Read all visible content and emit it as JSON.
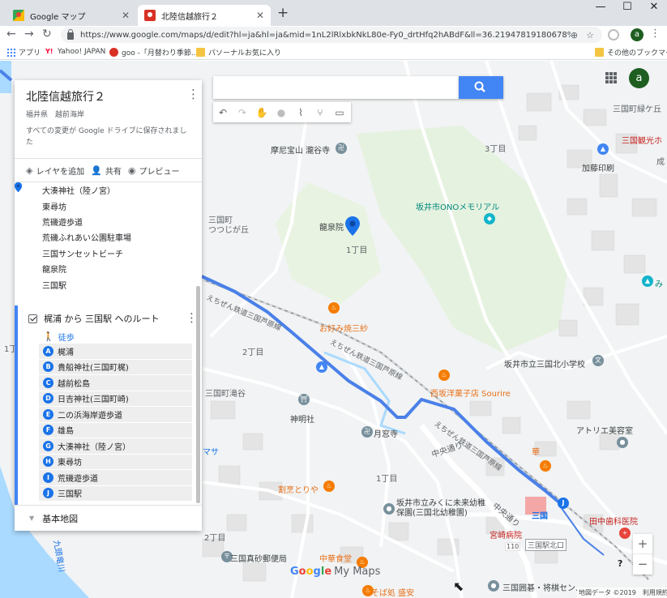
{
  "browser": {
    "tabs": [
      {
        "title": "Google マップ",
        "active": false
      },
      {
        "title": "北陸信越旅行２",
        "active": true
      }
    ],
    "new_tab": "+",
    "window_controls": [
      "—",
      "☐",
      "✕"
    ],
    "url": "https://www.google.com/maps/d/edit?hl=ja&hl=ja&mid=1nL2lRlxbkNkL80e-Fy0_drtHfq2hABdF&ll=36.21947819180678%2C136.1459475...",
    "account_initial": "a",
    "bookmarks": [
      {
        "label": "アプリ",
        "icon": "apps-grid-icon"
      },
      {
        "label": "Yahoo! JAPAN",
        "icon": "yahoo-icon"
      },
      {
        "label": "goo -「月替わり季節...",
        "icon": "goo-icon"
      },
      {
        "label": "パソーナルお気に入り",
        "icon": "folder-icon"
      }
    ],
    "other_bookmarks": "その他のブックマーク"
  },
  "panel": {
    "title": "北陸信越旅行２",
    "subtitle": "福井県　越前海岸",
    "save_note": "すべての変更が Google ドライブに保存されました",
    "actions": {
      "add_layer": "レイヤを追加",
      "share": "共有",
      "preview": "プレビュー"
    },
    "places": [
      "大湊神社（陸ノ宮）",
      "東尋坊",
      "荒磯遊歩道",
      "荒磯ふれあい公園駐車場",
      "三国サンセットビーチ",
      "龍泉院",
      "三国駅"
    ],
    "route": {
      "title": "梶浦 から 三国駅 へのルート",
      "mode": "徒歩",
      "stops": [
        {
          "letter": "A",
          "name": "梶浦"
        },
        {
          "letter": "B",
          "name": "貴船神社(三国町梶)"
        },
        {
          "letter": "C",
          "name": "越前松島"
        },
        {
          "letter": "D",
          "name": "日吉神社(三国町崎)"
        },
        {
          "letter": "E",
          "name": "二の浜海岸遊歩道"
        },
        {
          "letter": "F",
          "name": "雄島"
        },
        {
          "letter": "G",
          "name": "大湊神社（陸ノ宮）"
        },
        {
          "letter": "H",
          "name": "東尋坊"
        },
        {
          "letter": "I",
          "name": "荒磯遊歩道"
        },
        {
          "letter": "J",
          "name": "三国駅"
        }
      ]
    },
    "base_map": "基本地図"
  },
  "map": {
    "labels": {
      "temple_top": "摩尼宝山 瀧谷寺",
      "ward_3": "3丁目",
      "district_top": "三国町緑ケ丘",
      "katou": "加藤印刷",
      "kanko": "三国観光ホ",
      "nari": "成",
      "memorial": "坂井市ONOメモリアル",
      "ryusenin": "龍泉院",
      "ward_1a": "1丁目",
      "tsutsuji": "三国町\nつつじが丘",
      "mi": "み",
      "rail1": "えちぜん鉄道三国芦原線",
      "rail2": "えちぜん鉄道三国芦原線",
      "rail3": "えちぜん鉄道三国芦原線",
      "okonomi": "お好み焼三紗",
      "ward_2": "2丁目",
      "school": "坂井市立三国北小学校",
      "sourire": "西坂洋菓子店 Sourire",
      "takitani": "三国町滝谷",
      "shinmei": "神明社",
      "gatsuko": "月窓寺",
      "chuo": "中央通り",
      "atelier": "アトリエ美容室",
      "hana": "華",
      "ward_1b": "1丁目",
      "warppo": "割烹とりや",
      "nursery": "坂井市立みくに未来幼稚\n保園(三国北幼稚園)",
      "chuo2": "中央通り",
      "mikuni_tag": "三国",
      "tanaka": "田中歯科医院",
      "miyato": "宮崎病院",
      "station_north": "三国駅北口",
      "ward_2b": "2丁目",
      "post": "三国真砂郵便局",
      "chuka": "中華食堂",
      "route_110": "110",
      "soba": "そば処 盛安",
      "goban": "三国囲碁・将棋セン...",
      "kuzuryu": "九頭竜川",
      "ward_1c": "1丁",
      "masa": "マサ"
    },
    "route_color": "#4a80e8",
    "logo_text": "Google",
    "logo_suffix": "My Maps",
    "attribution": "地図データ ©2019　利用規約",
    "zoom_in": "+",
    "zoom_out": "−",
    "help": "?"
  }
}
